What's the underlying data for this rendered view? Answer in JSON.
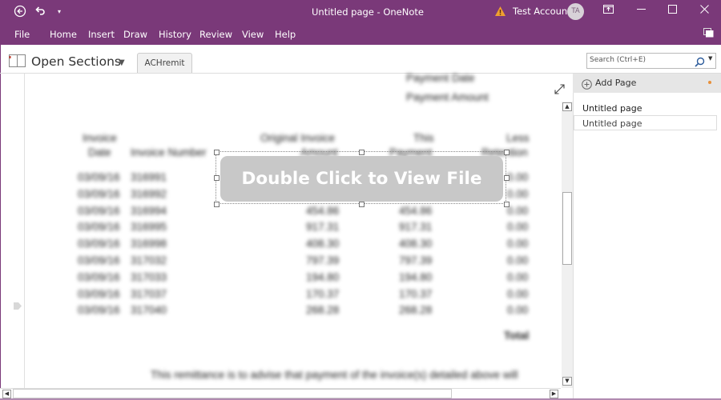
{
  "titlebar": {
    "title": "Untitled page  -  OneNote",
    "account_name": "Test Account",
    "avatar_initials": "TA",
    "icons": [
      "back-icon",
      "undo-icon",
      "quick-access-dropdown-icon",
      "warning-icon",
      "fullscreen-icon",
      "minimize-icon",
      "maximize-icon",
      "close-icon"
    ]
  },
  "menu": {
    "items": [
      "File",
      "Home",
      "Insert",
      "Draw",
      "History",
      "Review",
      "View",
      "Help"
    ]
  },
  "notebook_bar": {
    "sections_label": "Open Sections",
    "active_tab": "ACHremit",
    "search_placeholder": "Search (Ctrl+E)"
  },
  "page": {
    "overlay_label": "Double Click to View File",
    "document": {
      "header_lines": [
        "Payment Date",
        "Payment Amount"
      ],
      "columns": [
        {
          "line1": "Invoice",
          "line2": "Date"
        },
        {
          "line1": "",
          "line2": "Invoice Number"
        },
        {
          "line1": "Original Invoice",
          "line2": "Amount"
        },
        {
          "line1": "This",
          "line2": "Payment"
        },
        {
          "line1": "Less",
          "line2": "Retention"
        }
      ],
      "rows": [
        [
          "03/09/16",
          "316991",
          "",
          "",
          "0.00"
        ],
        [
          "03/09/16",
          "316992",
          "",
          "",
          "0.00"
        ],
        [
          "03/09/16",
          "316994",
          "454.86",
          "454.86",
          "0.00"
        ],
        [
          "03/09/16",
          "316995",
          "917.31",
          "917.31",
          "0.00"
        ],
        [
          "03/09/16",
          "316998",
          "408.30",
          "408.30",
          "0.00"
        ],
        [
          "03/09/16",
          "317032",
          "797.39",
          "797.39",
          "0.00"
        ],
        [
          "03/09/16",
          "317033",
          "194.80",
          "194.80",
          "0.00"
        ],
        [
          "03/09/16",
          "317037",
          "170.37",
          "170.37",
          "0.00"
        ],
        [
          "03/09/16",
          "317040",
          "268.28",
          "268.28",
          "0.00"
        ]
      ],
      "total_label": "Total",
      "footer_line": "This remittance is to advise that payment of the invoice(s) detailed above will"
    }
  },
  "pages_panel": {
    "add_page_label": "Add Page",
    "pages": [
      "Untitled page",
      "Untitled page"
    ]
  }
}
